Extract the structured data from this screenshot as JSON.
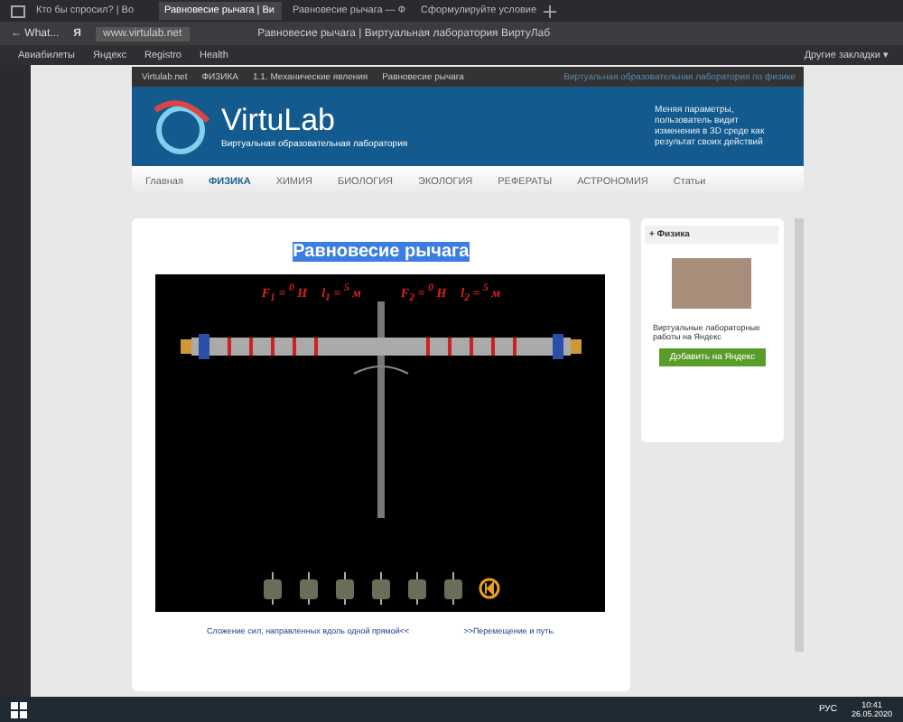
{
  "browser": {
    "tabs": [
      {
        "label": "Кто бы спросил? | Во",
        "selected": false
      },
      {
        "label": "Равновесие рычага | Ви",
        "selected": true
      },
      {
        "label": "Равновесие рычага — Ф",
        "selected": false
      },
      {
        "label": "Сформулируйте условие",
        "selected": false
      }
    ],
    "back_label": "← What...",
    "yandex": "Я",
    "url": "www.virtulab.net",
    "page_title": "Равновесие рычага | Виртуальная лаборатория ВиртуЛаб",
    "bookmarks": [
      "Авиабилеты",
      "Яндекс",
      "Registro",
      "Health"
    ],
    "other_bookmarks": "Другие закладки ▾"
  },
  "site": {
    "breadcrumb": [
      "Virtulab.net",
      "ФИЗИКА",
      "1.1. Механические явления",
      "Равновесие рычага"
    ],
    "top_right": "Виртуальная образовательная лаборатория по физике",
    "logo": "VirtuLab",
    "tagline": "Виртуальная образовательная лаборатория",
    "banner_note": "Меняя параметры, пользователь видит изменения в 3D среде как результат своих действий",
    "nav": [
      {
        "label": "Главная",
        "selected": false
      },
      {
        "label": "ФИЗИКА",
        "selected": true
      },
      {
        "label": "ХИМИЯ",
        "selected": false
      },
      {
        "label": "БИОЛОГИЯ",
        "selected": false
      },
      {
        "label": "ЭКОЛОГИЯ",
        "selected": false
      },
      {
        "label": "РЕФЕРАТЫ",
        "selected": false
      },
      {
        "label": "АСТРОНОМИЯ",
        "selected": false
      },
      {
        "label": "Статьи",
        "selected": false
      }
    ]
  },
  "main": {
    "title": "Равновесие рычага",
    "title_selected": true,
    "sim_labels": [
      "F$_{1}$ = $^{0}$ Н",
      "l$_{1}$ = $^{5}$ м",
      "F$_{2}$ = $^{0}$ Н",
      "l$_{2}$ = $^{5}$ м"
    ],
    "prev_link": "Сложение сил, направленных вдоль одной прямой<<",
    "next_link": ">>Перемещение и путь."
  },
  "aside": {
    "heading": "+ Физика",
    "caption": "Виртуальные лабораторные работы на Яндекс",
    "button": "Добавить на Яндекс"
  },
  "taskbar": {
    "lang": "РУС",
    "time": "10:41",
    "date": "26.05.2020"
  }
}
